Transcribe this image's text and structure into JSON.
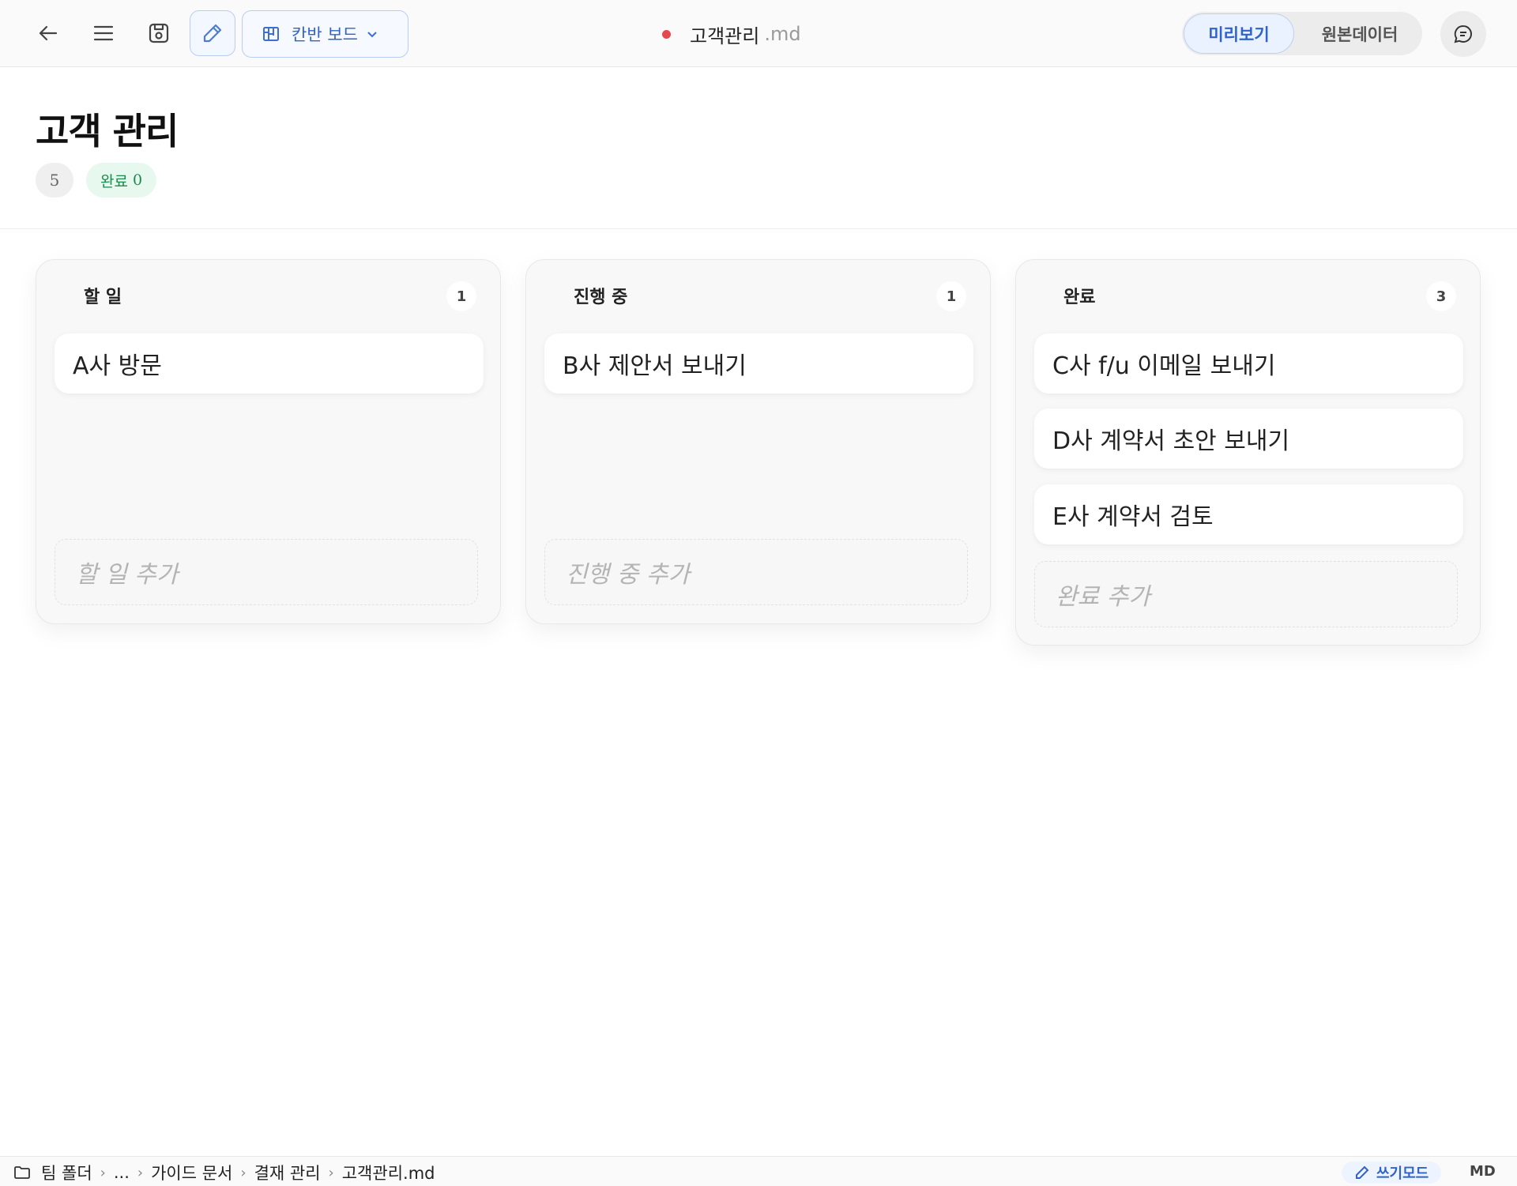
{
  "toolbar": {
    "back_icon": "arrow-left-icon",
    "menu_icon": "hamburger-menu-icon",
    "save_icon": "save-icon",
    "edit_icon": "pencil-icon",
    "view_select": {
      "label": "칸반 보드",
      "icon": "kanban-icon"
    },
    "file": {
      "name": "고객관리",
      "ext": ".md",
      "unsaved": true
    },
    "mode_tabs": [
      {
        "label": "미리보기",
        "active": true
      },
      {
        "label": "원본데이터",
        "active": false
      }
    ],
    "chat_icon": "chat-icon"
  },
  "page": {
    "title": "고객 관리",
    "total_count": "5",
    "done_badge": {
      "label": "완료",
      "count": "0"
    }
  },
  "columns": [
    {
      "title": "할 일",
      "count": "1",
      "cards": [
        "A사 방문"
      ],
      "add_placeholder": "할 일 추가"
    },
    {
      "title": "진행 중",
      "count": "1",
      "cards": [
        "B사 제안서 보내기"
      ],
      "add_placeholder": "진행 중 추가"
    },
    {
      "title": "완료",
      "count": "3",
      "cards": [
        "C사 f/u 이메일 보내기",
        "D사 계약서 초안 보내기",
        "E사 계약서 검토"
      ],
      "add_placeholder": "완료 추가"
    }
  ],
  "statusbar": {
    "breadcrumb": [
      "팀 폴더",
      "...",
      "가이드 문서",
      "결재 관리",
      "고객관리.md"
    ],
    "write_mode": "쓰기모드",
    "format": "MD"
  },
  "colors": {
    "accent": "#2f63c9",
    "unsaved_dot": "#e5484d",
    "done_green": "#1c8a4f"
  }
}
